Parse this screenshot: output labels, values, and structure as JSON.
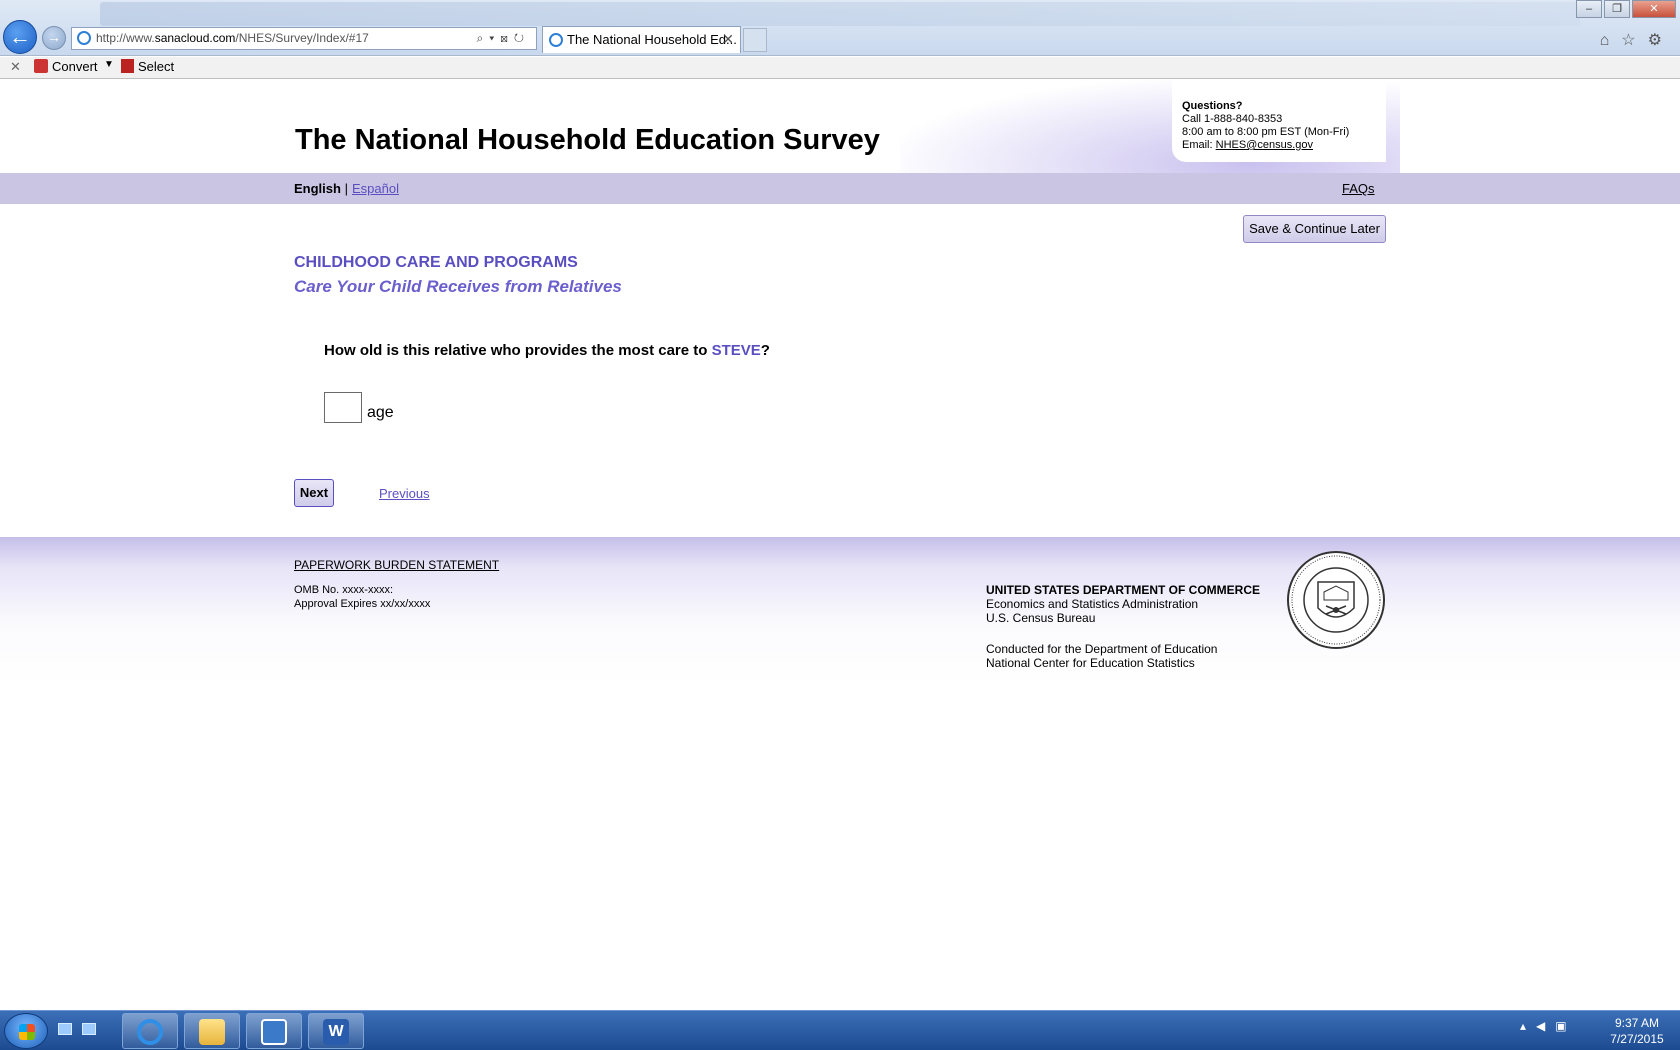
{
  "browser": {
    "url_prefix": "http://www.",
    "url_domain": "sanacloud.com",
    "url_path": "/NHES/Survey/Index/#17",
    "tab_title": "The National Household Ed...",
    "tab_close": "✕",
    "cmd_close": "✕",
    "convert_label": "Convert",
    "select_label": "Select"
  },
  "header": {
    "site_title": "The National Household Education Survey",
    "questions_title": "Questions?",
    "call_line": "Call 1-888-840-8353",
    "hours_line": "8:00 am to 8:00 pm EST (Mon-Fri)",
    "email_prefix": "Email: ",
    "email": "NHES@census.gov"
  },
  "langbar": {
    "english": "English",
    "separator": "|",
    "espanol": "Español",
    "faqs": "FAQs"
  },
  "main": {
    "save_button": "Save & Continue Later",
    "section_title": "CHILDHOOD CARE AND PROGRAMS",
    "subsection_title": "Care Your Child Receives from Relatives",
    "question_prefix": "How old is this relative who provides the most care to ",
    "child_name": "STEVE",
    "question_suffix": "?",
    "age_value": "",
    "age_label": "age",
    "next_button": "Next",
    "previous_link": "Previous"
  },
  "footer": {
    "paperwork_link": "PAPERWORK BURDEN STATEMENT",
    "omb": "OMB No. xxxx-xxxx:",
    "approval": "Approval Expires xx/xx/xxxx",
    "dept": "UNITED STATES DEPARTMENT OF COMMERCE",
    "esa": "Economics and Statistics Administration",
    "bureau": "U.S. Census Bureau",
    "conducted_1": "Conducted for the Department of Education",
    "conducted_2": "National Center for Education Statistics"
  },
  "taskbar": {
    "word_letter": "W",
    "time": "9:37 AM",
    "date": "7/27/2015"
  },
  "colors": {
    "accent_purple": "#5a4fc0",
    "langbar_bg": "#c9c5e3",
    "taskbar_blue": "#1d4b91"
  },
  "icons": [
    "back-arrow-icon",
    "forward-arrow-icon",
    "ie-icon",
    "search-icon",
    "refresh-icon",
    "home-icon",
    "star-icon",
    "gear-icon",
    "census-seal",
    "windows-start-icon",
    "file-explorer-icon",
    "lync-icon",
    "word-icon"
  ]
}
